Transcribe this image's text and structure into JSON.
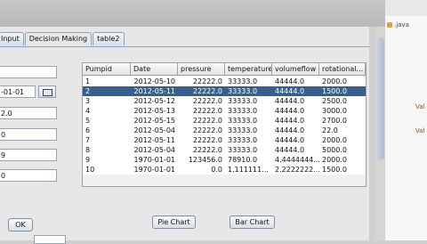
{
  "tabs": [
    {
      "label": "Input"
    },
    {
      "label": "Decision Making"
    },
    {
      "label": "table2"
    }
  ],
  "form": {
    "fields": [
      "",
      "-01-01",
      "2.0",
      "0",
      "9",
      "0"
    ]
  },
  "table": {
    "columns": [
      "Pumpid",
      "Date",
      "pressure",
      "temperature",
      "volumeflow",
      "rotational..."
    ],
    "rows": [
      [
        "1",
        "2012-05-10",
        "22222.0",
        "33333.0",
        "44444.0",
        "2000.0"
      ],
      [
        "2",
        "2012-05-11",
        "22222.0",
        "33333.0",
        "44444.0",
        "1500.0"
      ],
      [
        "3",
        "2012-05-12",
        "22222.0",
        "33333.0",
        "44444.0",
        "2500.0"
      ],
      [
        "4",
        "2012-05-13",
        "22222.0",
        "33333.0",
        "44444.0",
        "3000.0"
      ],
      [
        "5",
        "2012-05-15",
        "22222.0",
        "33333.0",
        "44444.0",
        "2700.0"
      ],
      [
        "6",
        "2012-05-04",
        "22222.0",
        "33333.0",
        "44444.0",
        "22.0"
      ],
      [
        "7",
        "2012-05-11",
        "22222.0",
        "33333.0",
        "44444.0",
        "2000.0"
      ],
      [
        "8",
        "2012-05-04",
        "22222.0",
        "33333.0",
        "44444.0",
        "5000.0"
      ],
      [
        "9",
        "1970-01-01",
        "123456.0",
        "78910.0",
        "4.4444444...",
        "2000.0"
      ],
      [
        "10",
        "1970-01-01",
        "0.0",
        "1.111111...",
        "2.2222222...",
        "1500.0"
      ]
    ],
    "selected_row": 1
  },
  "buttons": {
    "ok": "OK",
    "pie_chart": "Pie Chart",
    "bar_chart": "Bar Chart"
  },
  "editor": {
    "tab_text": ".java",
    "code_1": "Val",
    "code_2": "Val"
  }
}
